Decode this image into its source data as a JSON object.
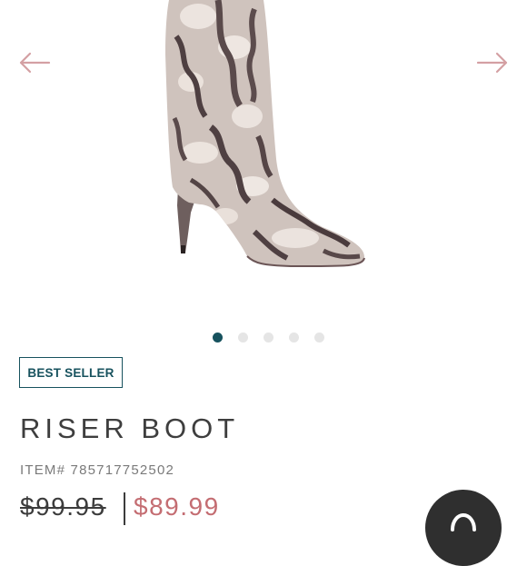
{
  "carousel": {
    "image_icon": "snakeskin-boot-image",
    "prev_icon": "arrow-left-icon",
    "next_icon": "arrow-right-icon",
    "total_slides": 5,
    "active_slide": 1,
    "arrow_color": "#d4a0a3",
    "active_dot_color": "#17525e",
    "inactive_dot_color": "#e5e5e5"
  },
  "product": {
    "badge": "BEST SELLER",
    "title": "RISER BOOT",
    "item_number": "ITEM# 785717752502",
    "original_price": "$99.95",
    "sale_price": "$89.99",
    "sale_price_color": "#c46d72",
    "badge_color": "#17525e"
  },
  "chat": {
    "icon": "chat-bubble-icon",
    "button_color": "#2f2f2f"
  }
}
